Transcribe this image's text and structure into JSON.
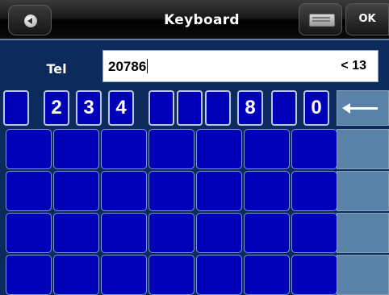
{
  "header": {
    "title": "Keyboard",
    "ok_label": "OK",
    "back_icon": "back-circle-icon",
    "keyboard_icon": "keyboard-icon"
  },
  "input": {
    "label": "Tel",
    "value": "20786",
    "counter": "< 13"
  },
  "keys": {
    "digit_row": [
      "",
      "2",
      "3",
      "4",
      "",
      "",
      "",
      "8",
      "",
      "0"
    ],
    "backspace_icon": "backspace-arrow-icon"
  },
  "colors": {
    "key_blue": "#0000b8",
    "background": "#0d2a5c",
    "side_key": "#5a82a6"
  }
}
